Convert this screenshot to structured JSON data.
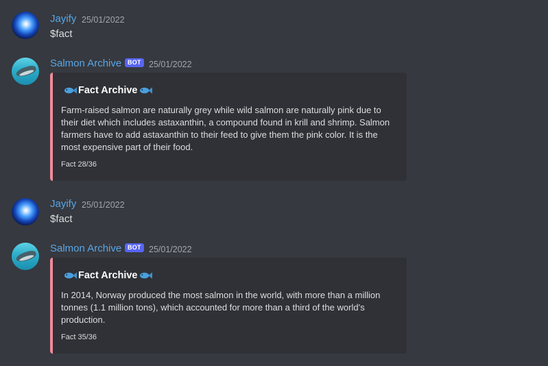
{
  "messages": [
    {
      "author": "Jayify",
      "timestamp": "25/01/2022",
      "content": "$fact"
    },
    {
      "author": "Salmon Archive",
      "badge": "BOT",
      "timestamp": "25/01/2022",
      "embed": {
        "title": "Fact Archive",
        "description": "Farm-raised salmon are naturally grey while wild salmon are naturally pink due to their diet which includes astaxanthin, a compound found in krill and shrimp. Salmon farmers have to add astaxanthin to their feed to give them the pink color. It is the most expensive part of their food.",
        "footer": "Fact 28/36"
      }
    },
    {
      "author": "Jayify",
      "timestamp": "25/01/2022",
      "content": "$fact"
    },
    {
      "author": "Salmon Archive",
      "badge": "BOT",
      "timestamp": "25/01/2022",
      "embed": {
        "title": "Fact Archive",
        "description": "In 2014, Norway produced the most salmon in the world, with more than a million tonnes (1.1 million tons), which accounted for more than a third of the world’s production.",
        "footer": "Fact 35/36"
      }
    }
  ],
  "colors": {
    "background": "#36393f",
    "embed_background": "#2f3136",
    "embed_accent": "#f08a9b",
    "username": "#58a6e6",
    "bot_badge": "#5865f2"
  },
  "icons": {
    "title_decoration": "fish-icon"
  }
}
